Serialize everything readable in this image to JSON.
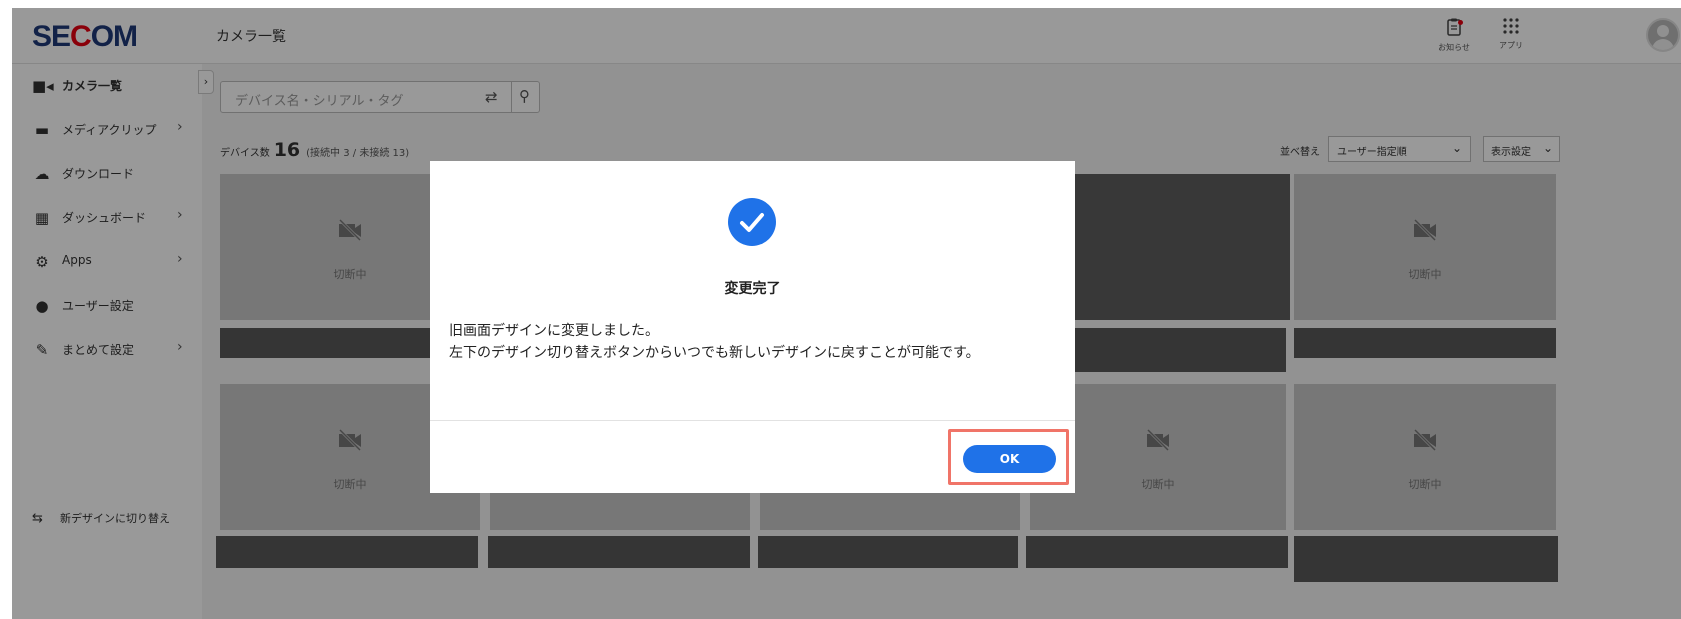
{
  "header": {
    "logo": "SECOM",
    "page_title": "カメラ一覧",
    "notifications_label": "お知らせ",
    "apps_label": "アプリ"
  },
  "sidebar": {
    "items": [
      {
        "label": "カメラ一覧",
        "icon": "camera-icon",
        "active": true
      },
      {
        "label": "メディアクリップ",
        "icon": "film-icon",
        "has_children": true
      },
      {
        "label": "ダウンロード",
        "icon": "cloud-download-icon"
      },
      {
        "label": "ダッシュボード",
        "icon": "dashboard-icon",
        "has_children": true
      },
      {
        "label": "Apps",
        "icon": "apps-icon",
        "has_children": true
      },
      {
        "label": "ユーザー設定",
        "icon": "user-icon"
      },
      {
        "label": "まとめて設定",
        "icon": "wrench-icon",
        "has_children": true
      }
    ],
    "switch_design_label": "新デザインに切り替え"
  },
  "main": {
    "search_placeholder": "デバイス名・シリアル・タグ",
    "device_count_label": "デバイス数",
    "device_count": "16",
    "device_count_detail": "(接続中 3 / 未接続 13)",
    "sort_label": "並べ替え",
    "sort_value": "ユーザー指定順",
    "display_settings_label": "表示設定",
    "tile_status": "切断中"
  },
  "dialog": {
    "title": "変更完了",
    "message_line1": "旧画面デザインに変更しました。",
    "message_line2": "左下のデザイン切り替えボタンからいつでも新しいデザインに戻すことが可能です。",
    "ok_label": "OK"
  },
  "colors": {
    "brand_blue": "#1e3a78",
    "accent_blue": "#1f72e8",
    "logo_red": "#e60012",
    "highlight": "#f07468"
  }
}
